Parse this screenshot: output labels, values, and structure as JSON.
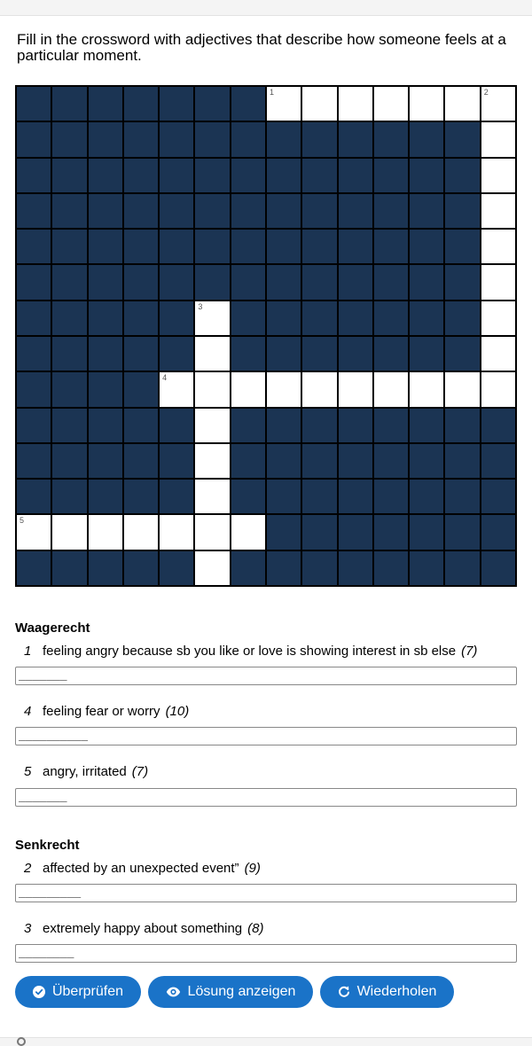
{
  "instructions": "Fill in the crossword with adjectives that describe how someone feels at a particular moment.",
  "across": {
    "title": "Waagerecht",
    "clues": [
      {
        "number": "1",
        "text": "feeling angry because sb you like or love is showing interest in sb else",
        "length": "(7)",
        "answer": "_______"
      },
      {
        "number": "4",
        "text": "feeling fear or worry",
        "length": "(10)",
        "answer": "__________"
      },
      {
        "number": "5",
        "text": "angry, irritated",
        "length": "(7)",
        "answer": "_______"
      }
    ]
  },
  "down": {
    "title": "Senkrecht",
    "clues": [
      {
        "number": "2",
        "text": "affected by an unexpected event”",
        "length": "(9)",
        "answer": "_________"
      },
      {
        "number": "3",
        "text": "extremely happy about something",
        "length": "(8)",
        "answer": "________"
      }
    ]
  },
  "buttons": {
    "check": "Überprüfen",
    "show": "Lösung anzeigen",
    "retry": "Wiederholen"
  },
  "colors": {
    "block": "#1b3453",
    "button": "#1a73c8"
  },
  "grid": {
    "rows": 14,
    "cols": 14,
    "pattern": [
      "#######.......",
      "#############.",
      "#############.",
      "#############.",
      "#############.",
      "#############.",
      "#####.#######.",
      "#####.#######.",
      "####..........",
      "#####.########",
      "#####.########",
      "#####.########",
      ".......#######",
      "#####.########"
    ],
    "numbers": [
      {
        "row": 0,
        "col": 7,
        "n": "1"
      },
      {
        "row": 0,
        "col": 13,
        "n": "2"
      },
      {
        "row": 6,
        "col": 5,
        "n": "3"
      },
      {
        "row": 8,
        "col": 4,
        "n": "4"
      },
      {
        "row": 12,
        "col": 0,
        "n": "5"
      }
    ]
  }
}
